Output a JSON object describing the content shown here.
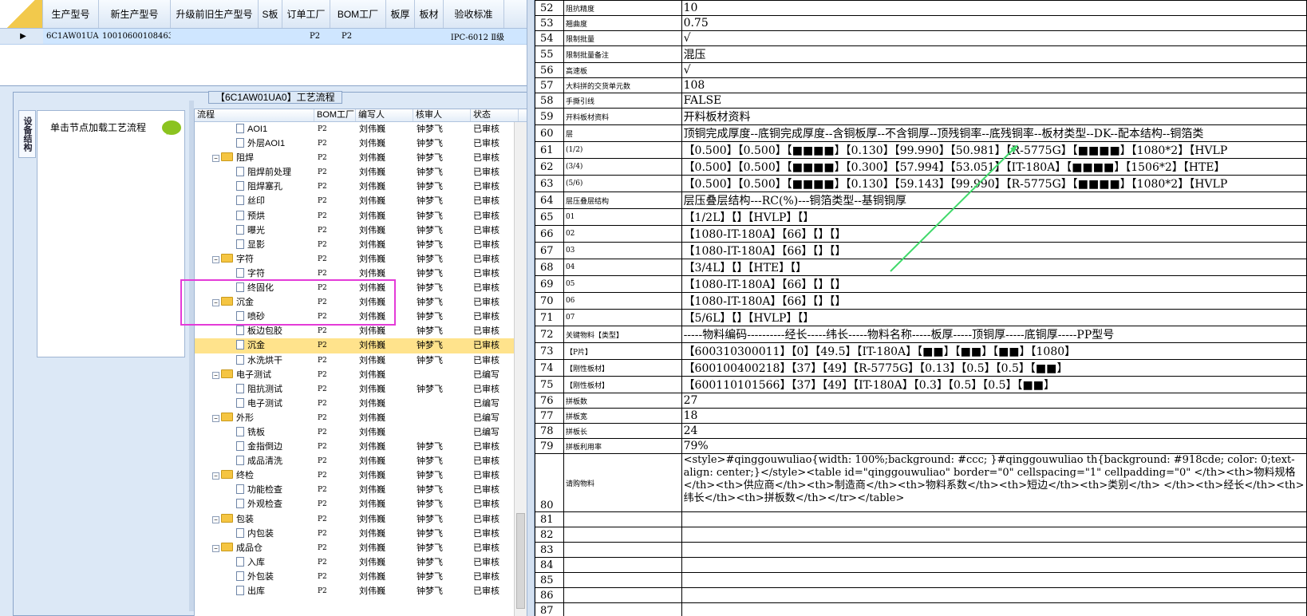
{
  "production_grid": {
    "headers": [
      "生产型号",
      "新生产型号",
      "升级前旧生产型号",
      "S板",
      "订单工厂",
      "BOM工厂",
      "板厚",
      "板材",
      "验收标准"
    ],
    "row": {
      "values": [
        "6C1AW01UA0",
        "10010600108463",
        "",
        "",
        "P2",
        "P2",
        "",
        "",
        "IPC-6012 Ⅱ级"
      ]
    }
  },
  "process_panel": {
    "caption": "【6C1AW01UA0】工艺流程",
    "vertical_tab": "设备结构",
    "node_hint": "单击节点加载工艺流程",
    "tree_headers": [
      "流程",
      "BOM工厂",
      "编写人",
      "核审人",
      "状态"
    ],
    "tree_rows": [
      {
        "label": "AOI1",
        "level": 1,
        "type": "leaf",
        "bom": "P2",
        "writer": "刘伟巍",
        "reviewer": "钟梦飞",
        "status": "已审核"
      },
      {
        "label": "外层AOI1",
        "level": 1,
        "type": "leaf",
        "bom": "P2",
        "writer": "刘伟巍",
        "reviewer": "钟梦飞",
        "status": "已审核"
      },
      {
        "label": "阻焊",
        "level": 0,
        "type": "folder",
        "bom": "P2",
        "writer": "刘伟巍",
        "reviewer": "钟梦飞",
        "status": "已审核"
      },
      {
        "label": "阻焊前处理",
        "level": 1,
        "type": "leaf",
        "bom": "P2",
        "writer": "刘伟巍",
        "reviewer": "钟梦飞",
        "status": "已审核"
      },
      {
        "label": "阻焊塞孔",
        "level": 1,
        "type": "leaf",
        "bom": "P2",
        "writer": "刘伟巍",
        "reviewer": "钟梦飞",
        "status": "已审核"
      },
      {
        "label": "丝印",
        "level": 1,
        "type": "leaf",
        "bom": "P2",
        "writer": "刘伟巍",
        "reviewer": "钟梦飞",
        "status": "已审核"
      },
      {
        "label": "预烘",
        "level": 1,
        "type": "leaf",
        "bom": "P2",
        "writer": "刘伟巍",
        "reviewer": "钟梦飞",
        "status": "已审核"
      },
      {
        "label": "曝光",
        "level": 1,
        "type": "leaf",
        "bom": "P2",
        "writer": "刘伟巍",
        "reviewer": "钟梦飞",
        "status": "已审核"
      },
      {
        "label": "显影",
        "level": 1,
        "type": "leaf",
        "bom": "P2",
        "writer": "刘伟巍",
        "reviewer": "钟梦飞",
        "status": "已审核"
      },
      {
        "label": "字符",
        "level": 0,
        "type": "folder",
        "bom": "P2",
        "writer": "刘伟巍",
        "reviewer": "钟梦飞",
        "status": "已审核"
      },
      {
        "label": "字符",
        "level": 1,
        "type": "leaf",
        "bom": "P2",
        "writer": "刘伟巍",
        "reviewer": "钟梦飞",
        "status": "已审核"
      },
      {
        "label": "终固化",
        "level": 1,
        "type": "leaf",
        "bom": "P2",
        "writer": "刘伟巍",
        "reviewer": "钟梦飞",
        "status": "已审核"
      },
      {
        "label": "沉金",
        "level": 0,
        "type": "folder",
        "bom": "P2",
        "writer": "刘伟巍",
        "reviewer": "钟梦飞",
        "status": "已审核"
      },
      {
        "label": "喷砂",
        "level": 1,
        "type": "leaf",
        "bom": "P2",
        "writer": "刘伟巍",
        "reviewer": "钟梦飞",
        "status": "已审核"
      },
      {
        "label": "板边包胶",
        "level": 1,
        "type": "leaf",
        "bom": "P2",
        "writer": "刘伟巍",
        "reviewer": "钟梦飞",
        "status": "已审核"
      },
      {
        "label": "沉金",
        "level": 1,
        "type": "leaf",
        "selected": true,
        "bom": "P2",
        "writer": "刘伟巍",
        "reviewer": "钟梦飞",
        "status": "已审核"
      },
      {
        "label": "水洗烘干",
        "level": 1,
        "type": "leaf",
        "bom": "P2",
        "writer": "刘伟巍",
        "reviewer": "钟梦飞",
        "status": "已审核"
      },
      {
        "label": "电子测试",
        "level": 0,
        "type": "folder",
        "bom": "P2",
        "writer": "刘伟巍",
        "reviewer": "",
        "status": "已编写"
      },
      {
        "label": "阻抗测试",
        "level": 1,
        "type": "leaf",
        "bom": "P2",
        "writer": "刘伟巍",
        "reviewer": "钟梦飞",
        "status": "已审核"
      },
      {
        "label": "电子测试",
        "level": 1,
        "type": "leaf",
        "bom": "P2",
        "writer": "刘伟巍",
        "reviewer": "",
        "status": "已编写"
      },
      {
        "label": "外形",
        "level": 0,
        "type": "folder",
        "bom": "P2",
        "writer": "刘伟巍",
        "reviewer": "",
        "status": "已编写"
      },
      {
        "label": "铣板",
        "level": 1,
        "type": "leaf",
        "bom": "P2",
        "writer": "刘伟巍",
        "reviewer": "",
        "status": "已编写"
      },
      {
        "label": "金指倒边",
        "level": 1,
        "type": "leaf",
        "bom": "P2",
        "writer": "刘伟巍",
        "reviewer": "钟梦飞",
        "status": "已审核"
      },
      {
        "label": "成品清洗",
        "level": 1,
        "type": "leaf",
        "bom": "P2",
        "writer": "刘伟巍",
        "reviewer": "钟梦飞",
        "status": "已审核"
      },
      {
        "label": "终检",
        "level": 0,
        "type": "folder",
        "bom": "P2",
        "writer": "刘伟巍",
        "reviewer": "钟梦飞",
        "status": "已审核"
      },
      {
        "label": "功能检查",
        "level": 1,
        "type": "leaf",
        "bom": "P2",
        "writer": "刘伟巍",
        "reviewer": "钟梦飞",
        "status": "已审核"
      },
      {
        "label": "外观检查",
        "level": 1,
        "type": "leaf",
        "bom": "P2",
        "writer": "刘伟巍",
        "reviewer": "钟梦飞",
        "status": "已审核"
      },
      {
        "label": "包装",
        "level": 0,
        "type": "folder",
        "bom": "P2",
        "writer": "刘伟巍",
        "reviewer": "钟梦飞",
        "status": "已审核"
      },
      {
        "label": "内包装",
        "level": 1,
        "type": "leaf",
        "bom": "P2",
        "writer": "刘伟巍",
        "reviewer": "钟梦飞",
        "status": "已审核"
      },
      {
        "label": "成品仓",
        "level": 0,
        "type": "folder",
        "bom": "P2",
        "writer": "刘伟巍",
        "reviewer": "钟梦飞",
        "status": "已审核"
      },
      {
        "label": "入库",
        "level": 1,
        "type": "leaf",
        "bom": "P2",
        "writer": "刘伟巍",
        "reviewer": "钟梦飞",
        "status": "已审核"
      },
      {
        "label": "外包装",
        "level": 1,
        "type": "leaf",
        "bom": "P2",
        "writer": "刘伟巍",
        "reviewer": "钟梦飞",
        "status": "已审核"
      },
      {
        "label": "出库",
        "level": 1,
        "type": "leaf",
        "bom": "P2",
        "writer": "刘伟巍",
        "reviewer": "钟梦飞",
        "status": "已审核"
      }
    ]
  },
  "spreadsheet": {
    "rows": [
      {
        "num": "52",
        "label": "阻抗精度",
        "value": "10"
      },
      {
        "num": "53",
        "label": "翘曲度",
        "value": "0.75"
      },
      {
        "num": "54",
        "label": "限制批量",
        "value": "√"
      },
      {
        "num": "55",
        "label": "限制批量备注",
        "value": "混压"
      },
      {
        "num": "56",
        "label": "高速板",
        "value": "√"
      },
      {
        "num": "57",
        "label": "大料拼的交货单元数",
        "value": "108"
      },
      {
        "num": "58",
        "label": "手撕引线",
        "value": "FALSE"
      },
      {
        "num": "59",
        "label": "开料板材资料",
        "value": "开料板材资料"
      },
      {
        "num": "60",
        "label": "层",
        "value": "顶铜完成厚度--底铜完成厚度--含铜板厚--不含铜厚--顶残铜率--底残铜率--板材类型--DK--配本结构--铜箔类"
      },
      {
        "num": "61",
        "label": "(1/2)",
        "value": "【0.500】【0.500】【■■■■】【0.130】【99.990】【50.981】【R-5775G】【■■■■】【1080*2】【HVLP"
      },
      {
        "num": "62",
        "label": "(3/4)",
        "value": "【0.500】【0.500】【■■■■】【0.300】【57.994】【53.051】【IT-180A】【■■■■】【1506*2】【HTE】"
      },
      {
        "num": "63",
        "label": "(5/6)",
        "value": "【0.500】【0.500】【■■■■】【0.130】【59.143】【99.990】【R-5775G】【■■■■】【1080*2】【HVLP"
      },
      {
        "num": "64",
        "label": "层压叠层结构",
        "value": "层压叠层结构---RC(%)---铜箔类型--基铜铜厚"
      },
      {
        "num": "65",
        "label": "01",
        "value": "【1/2L】【】【HVLP】【】"
      },
      {
        "num": "66",
        "label": "02",
        "value": "【1080-IT-180A】【66】【】【】"
      },
      {
        "num": "67",
        "label": "03",
        "value": "【1080-IT-180A】【66】【】【】"
      },
      {
        "num": "68",
        "label": "04",
        "value": "【3/4L】【】【HTE】【】"
      },
      {
        "num": "69",
        "label": "05",
        "value": "【1080-IT-180A】【66】【】【】"
      },
      {
        "num": "70",
        "label": "06",
        "value": "【1080-IT-180A】【66】【】【】"
      },
      {
        "num": "71",
        "label": "07",
        "value": "【5/6L】【】【HVLP】【】"
      },
      {
        "num": "72",
        "label": "关键物料【类型】",
        "value": "-----物料编码----------经长-----纬长-----物料名称-----板厚-----顶铜厚-----底铜厚-----PP型号"
      },
      {
        "num": "73",
        "label": "【P片】",
        "value": "【600310300011】【0】【49.5】【IT-180A】【■■】【■■】【■■】【1080】"
      },
      {
        "num": "74",
        "label": "【刚性板材】",
        "value": "【600100400218】【37】【49】【R-5775G】【0.13】【0.5】【0.5】【■■】"
      },
      {
        "num": "75",
        "label": "【刚性板材】",
        "value": "【600110101566】【37】【49】【IT-180A】【0.3】【0.5】【0.5】【■■】"
      },
      {
        "num": "76",
        "label": "拼板数",
        "value": "27"
      },
      {
        "num": "77",
        "label": "拼板宽",
        "value": "18"
      },
      {
        "num": "78",
        "label": "拼板长",
        "value": "24"
      },
      {
        "num": "79",
        "label": "拼板利用率",
        "value": "79%"
      },
      {
        "num": "80",
        "label": "请购物料",
        "value": "<style>#qinggouwuliao{width: 100%;background: #ccc; }#qinggouwuliao th{background: #918cde; color: 0;text-align: center;}</style><table id=\"qinggouwuliao\" border=\"0\" cellspacing=\"1\" cellpadding=\"0\" </th><th>物料规格</th><th>供应商</th><th>制造商</th><th>物料系数</th><th>短边</th><th>类别</th> </th><th>经长</th><th>纬长</th><th>拼板数</th></tr></table>",
        "tall": true
      },
      {
        "num": "81",
        "label": "",
        "value": ""
      },
      {
        "num": "82",
        "label": "",
        "value": ""
      },
      {
        "num": "83",
        "label": "",
        "value": ""
      },
      {
        "num": "84",
        "label": "",
        "value": ""
      },
      {
        "num": "85",
        "label": "",
        "value": ""
      },
      {
        "num": "86",
        "label": "",
        "value": ""
      },
      {
        "num": "87",
        "label": "",
        "value": ""
      },
      {
        "num": "88",
        "label": "",
        "value": ""
      }
    ]
  },
  "colors": {
    "selection": "#ffe38c",
    "highlight_box": "#e43bd8",
    "arrow": "#41d96b",
    "grid_row": "#cfe6ff"
  }
}
